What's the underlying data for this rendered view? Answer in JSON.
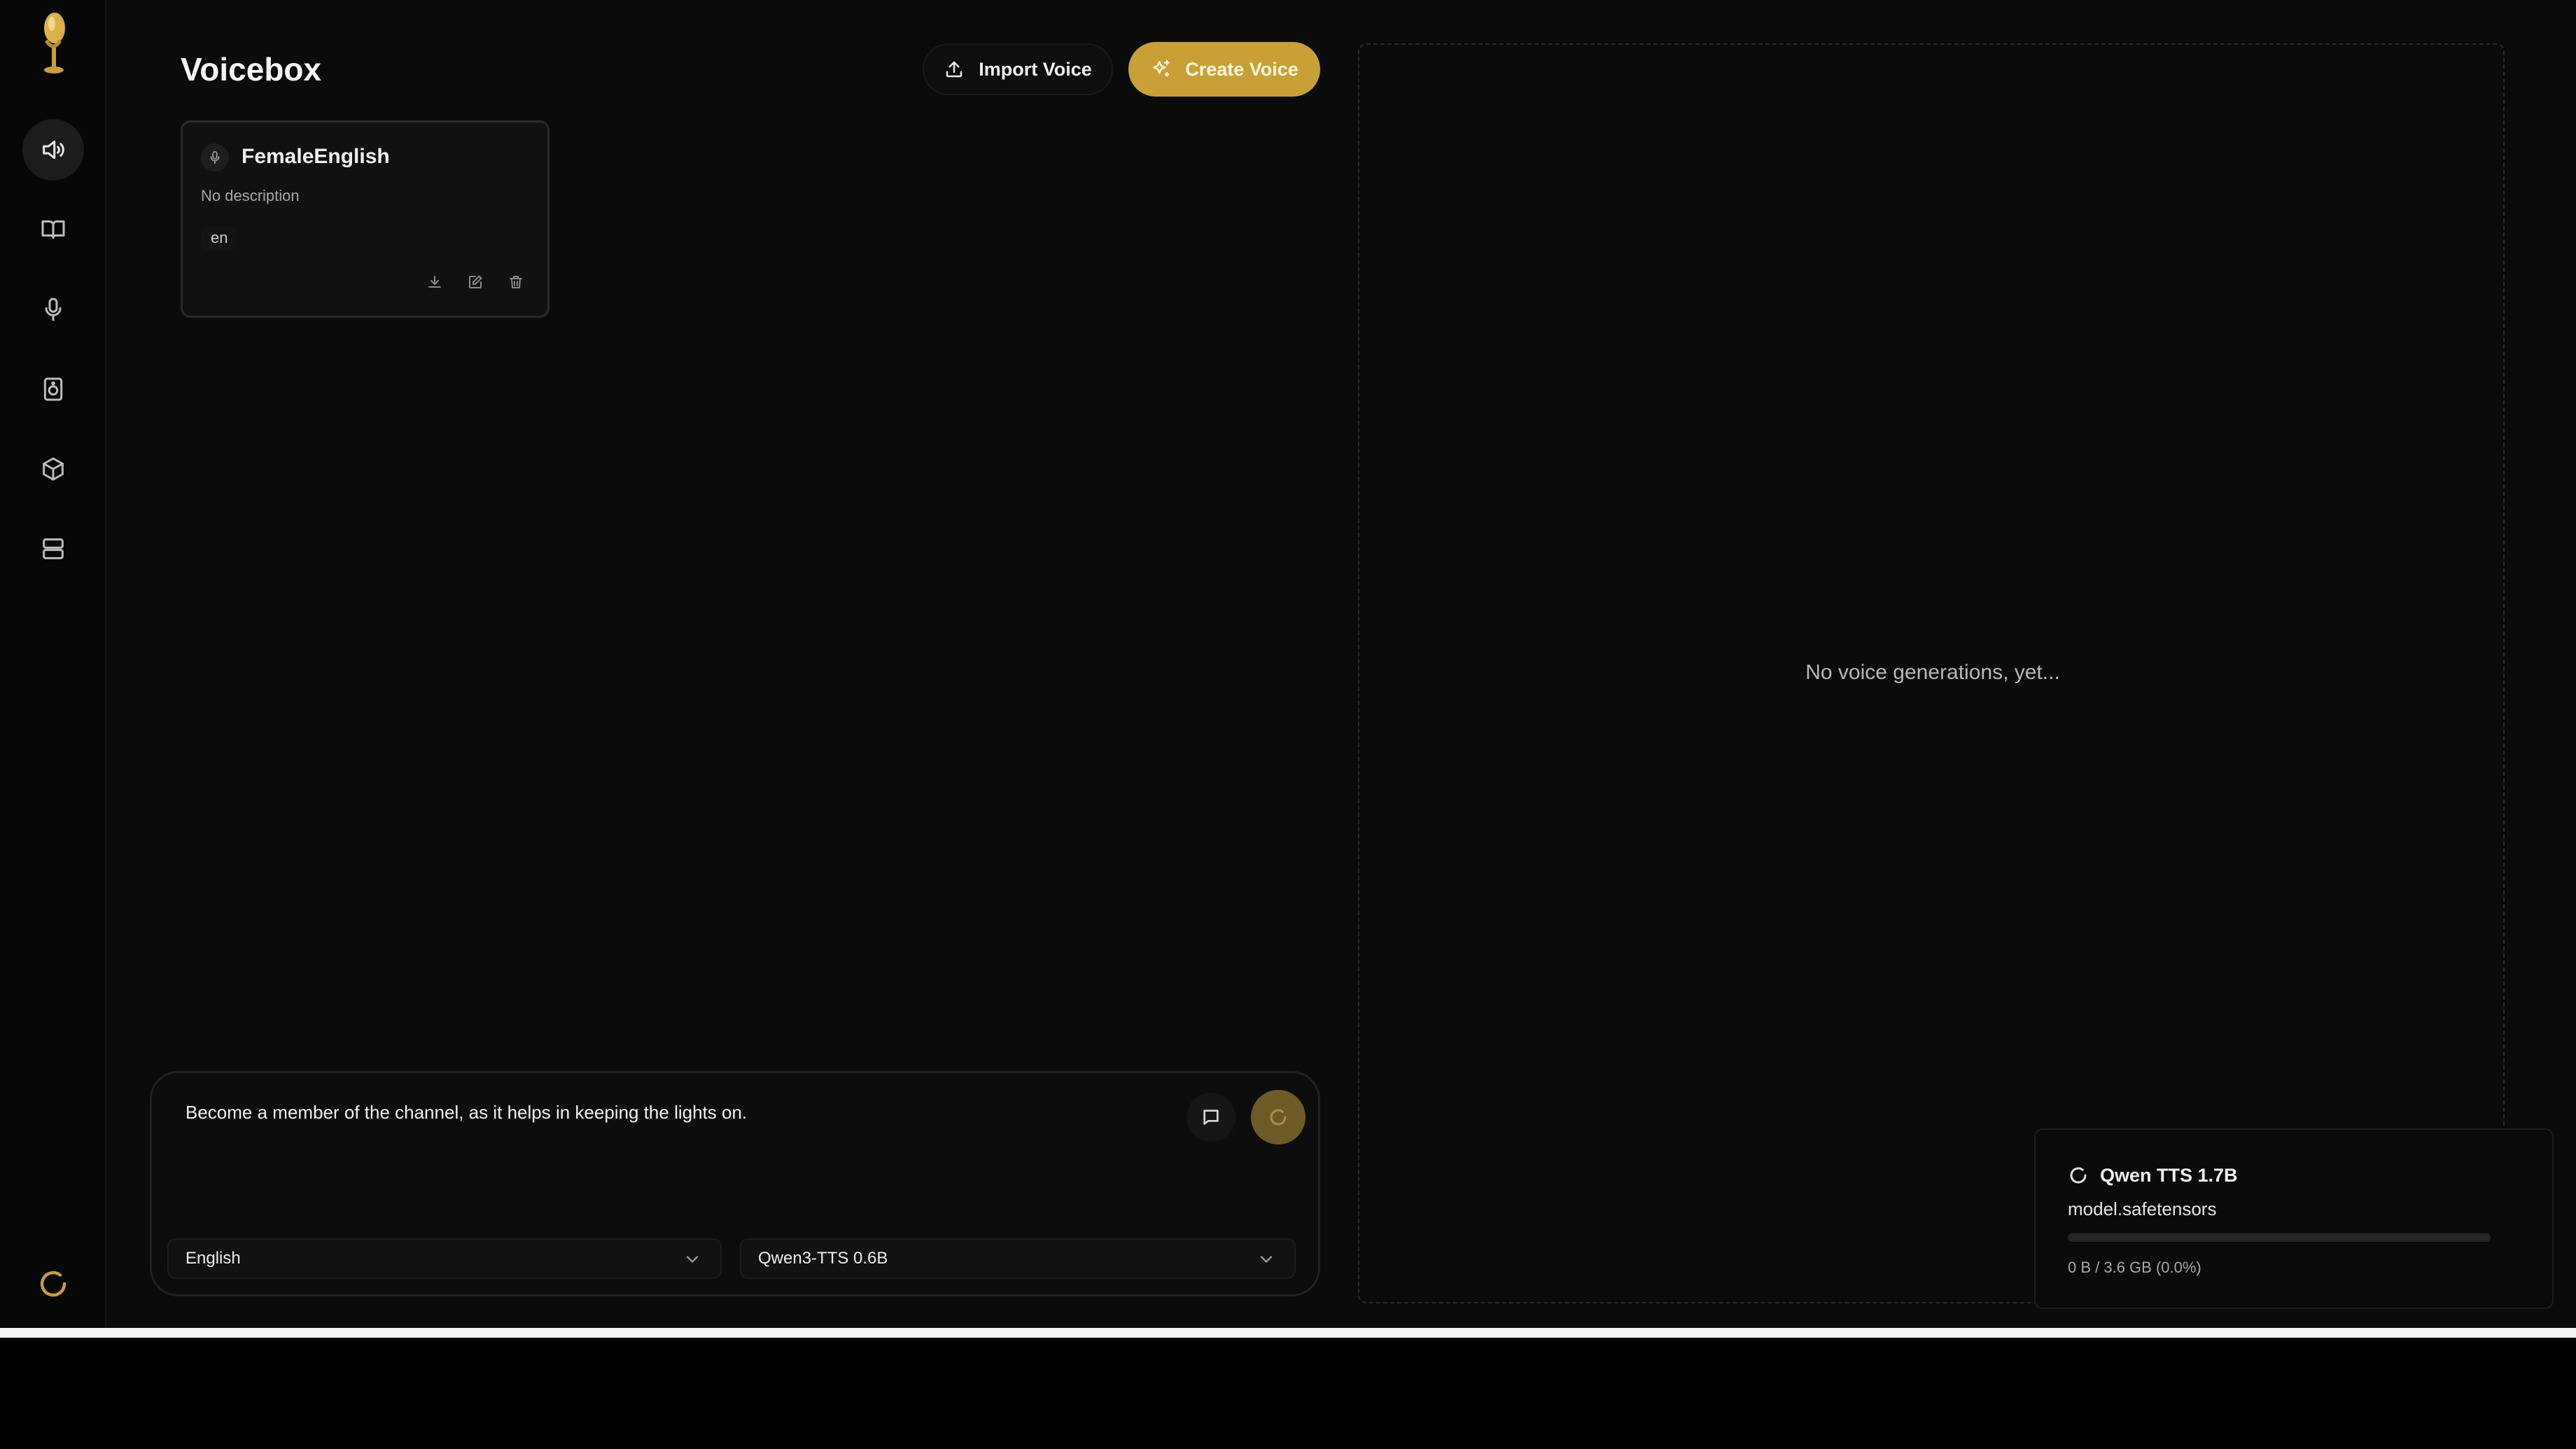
{
  "app": {
    "title": "Voicebox"
  },
  "header": {
    "import_label": "Import Voice",
    "create_label": "Create Voice"
  },
  "colors": {
    "accent": "#c9a035",
    "background": "#0b0b0b"
  },
  "sidebar": {
    "items": [
      {
        "icon": "speaker-icon",
        "active": true
      },
      {
        "icon": "book-icon",
        "active": false
      },
      {
        "icon": "microphone-icon",
        "active": false
      },
      {
        "icon": "audio-device-icon",
        "active": false
      },
      {
        "icon": "box-icon",
        "active": false
      },
      {
        "icon": "server-icon",
        "active": false
      }
    ]
  },
  "voices": [
    {
      "name": "FemaleEnglish",
      "description": "No description",
      "language": "en"
    }
  ],
  "generations": {
    "empty_message": "No voice generations, yet..."
  },
  "prompt": {
    "text": "Become a member of the channel, as it helps in keeping the lights on.",
    "language": "English",
    "model": "Qwen3-TTS 0.6B"
  },
  "download": {
    "title": "Qwen TTS 1.7B",
    "file": "model.safetensors",
    "size_text": "0 B / 3.6 GB (0.0%)",
    "progress_percent": 0
  }
}
